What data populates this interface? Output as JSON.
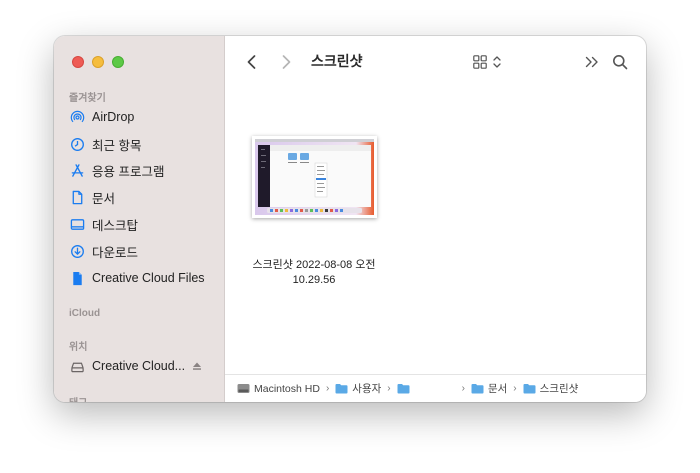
{
  "window": {
    "title": "스크린샷"
  },
  "sidebar": {
    "favorites_label": "즐겨찾기",
    "favorites": [
      {
        "label": "AirDrop",
        "icon": "airdrop-icon"
      },
      {
        "label": "최근 항목",
        "icon": "clock-icon"
      },
      {
        "label": "응용 프로그램",
        "icon": "applications-icon"
      },
      {
        "label": "문서",
        "icon": "document-icon"
      },
      {
        "label": "데스크탑",
        "icon": "desktop-icon"
      },
      {
        "label": "다운로드",
        "icon": "download-icon"
      },
      {
        "label": "Creative Cloud Files",
        "icon": "creative-cloud-file-icon"
      }
    ],
    "icloud_label": "iCloud",
    "locations_label": "위치",
    "locations": [
      {
        "label": "Creative Cloud...",
        "icon": "drive-icon"
      }
    ],
    "tags_label": "태그"
  },
  "file": {
    "name_line1": "스크린샷 2022-08-08 오전",
    "name_line2": "10.29.56"
  },
  "pathbar": {
    "segments": [
      "Macintosh HD",
      "사용자",
      "",
      "문서",
      "스크린샷"
    ]
  },
  "colors": {
    "accent": "#1a7cf0",
    "sidebar_bg": "#e8e1e0",
    "folder": "#5aa9e6"
  }
}
